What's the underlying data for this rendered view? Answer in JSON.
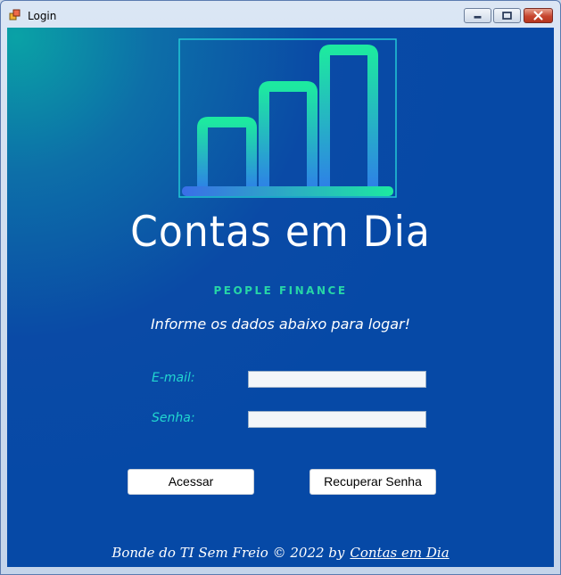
{
  "window": {
    "title": "Login"
  },
  "brand": {
    "name": "Contas em Dia",
    "tagline": "PEOPLE FINANCE"
  },
  "login": {
    "instruction": "Informe os dados abaixo para logar!",
    "email_label": "E-mail:",
    "email_value": "",
    "password_label": "Senha:",
    "password_value": "",
    "access_button": "Acessar",
    "recover_button": "Recuperar Senha"
  },
  "footer": {
    "text": "Bonde do TI Sem Freio © 2022  by",
    "link": "Contas em Dia"
  },
  "colors": {
    "background": "#0649a6",
    "accent_green": "#27d6a6",
    "label_cyan": "#22d7d0"
  },
  "icons": [
    "app-icon",
    "minimize-icon",
    "maximize-icon",
    "close-icon",
    "bar-chart-logo"
  ]
}
